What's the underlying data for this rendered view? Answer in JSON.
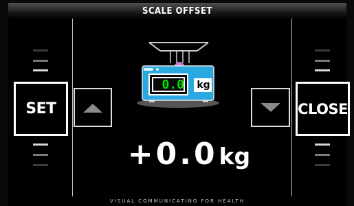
{
  "header": {
    "title": "SCALE OFFSET"
  },
  "buttons": {
    "set_label": "SET",
    "close_label": "CLOSE"
  },
  "scale_display": {
    "value": "0.0",
    "unit": "kg"
  },
  "readout": {
    "value": "+0.0",
    "unit": "kg"
  },
  "footer": {
    "text": "VISUAL COMMUNICATING FOR HEALTH"
  },
  "icons": {
    "increase": "triangle-up-icon",
    "decrease": "triangle-down-icon",
    "scale": "weighing-scale-icon"
  },
  "colors": {
    "background": "#000000",
    "scale_body": "#2aa8e0",
    "screen_text": "#00e000",
    "button_border": "#ffffff"
  }
}
